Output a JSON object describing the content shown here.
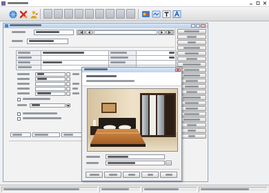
{
  "app": {
    "title": ""
  },
  "colors": {
    "app_title_bar": "#ffffff",
    "child_title_bar": "#c2d5ec",
    "dialog_title_bar": "#c9dcf2",
    "toolbar_disabled_button": "#c3c8ce",
    "accent_blue": "#2f7fd6",
    "delete_red": "#d42a1e",
    "user_yellow": "#f0b400"
  },
  "toolbar": {
    "left_icons": [
      "globe-icon",
      "delete-icon",
      "user-icon"
    ],
    "right_icons": [
      "color-icon",
      "wave-icon",
      "text-icon",
      "font-icon"
    ]
  },
  "editor": {
    "title": "",
    "item_label": "",
    "item_value": "",
    "record_label": "",
    "record_value": "",
    "grid": [
      [
        "",
        "",
        "",
        ""
      ],
      [
        "",
        "",
        "",
        ""
      ],
      [
        "",
        "",
        "",
        ""
      ],
      [
        "",
        "",
        "",
        ""
      ]
    ],
    "form_rows": [
      {
        "label": "",
        "value": "",
        "note": ""
      },
      {
        "label": "",
        "value": "",
        "note": ""
      },
      {
        "label": "",
        "value": "",
        "note": ""
      },
      {
        "label": "",
        "value": "",
        "note": ""
      },
      {
        "label": "",
        "value": "",
        "note": ""
      }
    ],
    "checkbox_label": "",
    "combo": {
      "label": "",
      "value": ""
    },
    "options": [
      "",
      ""
    ],
    "footer_fields": [
      "",
      "",
      ""
    ],
    "side_buttons": [
      "",
      "",
      "",
      "",
      "",
      "",
      "",
      "",
      "",
      "",
      "",
      "",
      "",
      "",
      "",
      "",
      "",
      "",
      "",
      ""
    ]
  },
  "dialog": {
    "title": "",
    "caption_line1": "",
    "caption_line2": "",
    "image": "bedroom-photo",
    "field1_label": "",
    "field1_value": "",
    "field2_label": "",
    "field2_value": "",
    "buttons": [
      "",
      "",
      "",
      "",
      ""
    ]
  },
  "status_bar": [
    "",
    "",
    "",
    ""
  ]
}
